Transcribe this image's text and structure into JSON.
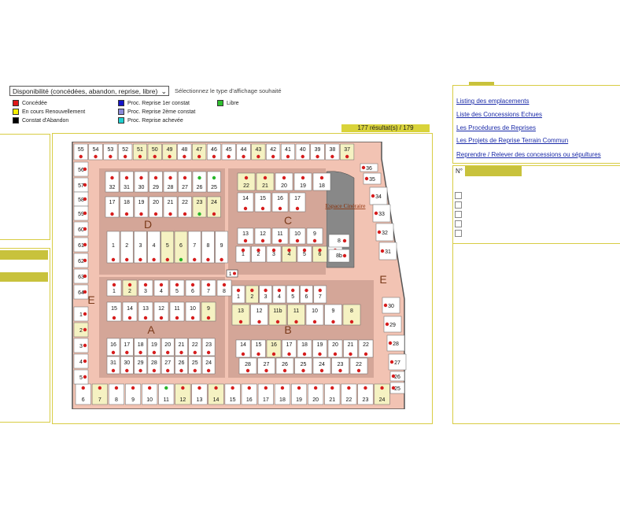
{
  "filter": {
    "selected": "Disponibilité (concédées, abandon, reprise, libre)",
    "hint": "Sélectionnez le type d'affichage souhaité"
  },
  "legend": [
    {
      "label": "Concédée",
      "color": "#e01818"
    },
    {
      "label": "En cours Renouvellement",
      "color": "#f6f000"
    },
    {
      "label": "Constat d'Abandon",
      "color": "#000000"
    },
    {
      "label": "Proc. Reprise 1er constat",
      "color": "#1414c8"
    },
    {
      "label": "Proc. Reprise 2ème constat",
      "color": "#8a8ad8"
    },
    {
      "label": "Proc. Reprise achevée",
      "color": "#20d0d0"
    },
    {
      "label": "Libre",
      "color": "#2ec02e"
    }
  ],
  "result_count": "177 résultat(s) / 179",
  "links": [
    "Listing des emplacements",
    "Liste des Concessions Echues",
    "Les Procédures de Reprises",
    "Les Projets de Reprise Terrain Commun",
    "Reprendre / Relever des concessions ou sépultures"
  ],
  "number_label": "N°",
  "map": {
    "sections": [
      "A",
      "B",
      "C",
      "D",
      "E",
      "E"
    ],
    "building": "Espace Cinéraire",
    "rows": [
      {
        "labels": [
          "55",
          "54",
          "53",
          "52",
          "51",
          "50",
          "49",
          "48",
          "47",
          "46",
          "45",
          "44",
          "43",
          "42",
          "41",
          "40",
          "39",
          "38",
          "37"
        ]
      },
      {
        "labels": [
          "32",
          "31",
          "30",
          "29",
          "28",
          "27",
          "26",
          "25"
        ]
      },
      {
        "labels": [
          "17",
          "18",
          "19",
          "20",
          "21",
          "22",
          "23",
          "24"
        ]
      },
      {
        "labels": [
          "1",
          "2",
          "3",
          "4",
          "5",
          "6",
          "7",
          "8",
          "9"
        ]
      },
      {
        "labels": [
          "1",
          "2",
          "3",
          "4",
          "5",
          "6",
          "7",
          "8"
        ]
      },
      {
        "labels": [
          "15",
          "14",
          "13",
          "12",
          "11",
          "10",
          "9"
        ]
      },
      {
        "labels": [
          "16",
          "17",
          "18",
          "19",
          "20",
          "21",
          "22",
          "23"
        ]
      },
      {
        "labels": [
          "31",
          "30",
          "29",
          "28",
          "27",
          "26",
          "25",
          "24"
        ]
      },
      {
        "labels": [
          "14",
          "15",
          "16",
          "17",
          "18",
          "19",
          "20",
          "21",
          "22"
        ]
      },
      {
        "labels": [
          "28",
          "27",
          "26",
          "25",
          "24",
          "23",
          "22"
        ]
      },
      {
        "labels": [
          "6",
          "7",
          "8",
          "9",
          "10",
          "11",
          "12",
          "13",
          "14",
          "15",
          "16",
          "17",
          "18",
          "19",
          "20",
          "21",
          "22",
          "23",
          "24"
        ]
      },
      {
        "labels": [
          "13",
          "12",
          "11b",
          "11",
          "10",
          "9",
          "8"
        ]
      },
      {
        "labels": [
          "1",
          "2",
          "3",
          "4",
          "5",
          "6",
          "7"
        ]
      },
      {
        "labels": [
          "14",
          "15",
          "16",
          "17"
        ]
      },
      {
        "labels": [
          "22",
          "21",
          "20",
          "19",
          "18"
        ]
      },
      {
        "labels": [
          "13",
          "12",
          "11",
          "10",
          "9"
        ]
      },
      {
        "labels": [
          "1",
          "2",
          "3",
          "4",
          "5",
          "6",
          "7"
        ]
      }
    ],
    "right_col": [
      "36",
      "35",
      "34",
      "33",
      "32",
      "31",
      "30",
      "29",
      "28",
      "27",
      "26",
      "25"
    ],
    "left_col": [
      "56",
      "57",
      "58",
      "59",
      "60",
      "61",
      "62",
      "63",
      "64",
      "1",
      "2",
      "3",
      "4",
      "5"
    ],
    "annex": [
      "8",
      "8b"
    ],
    "marker": "1"
  }
}
